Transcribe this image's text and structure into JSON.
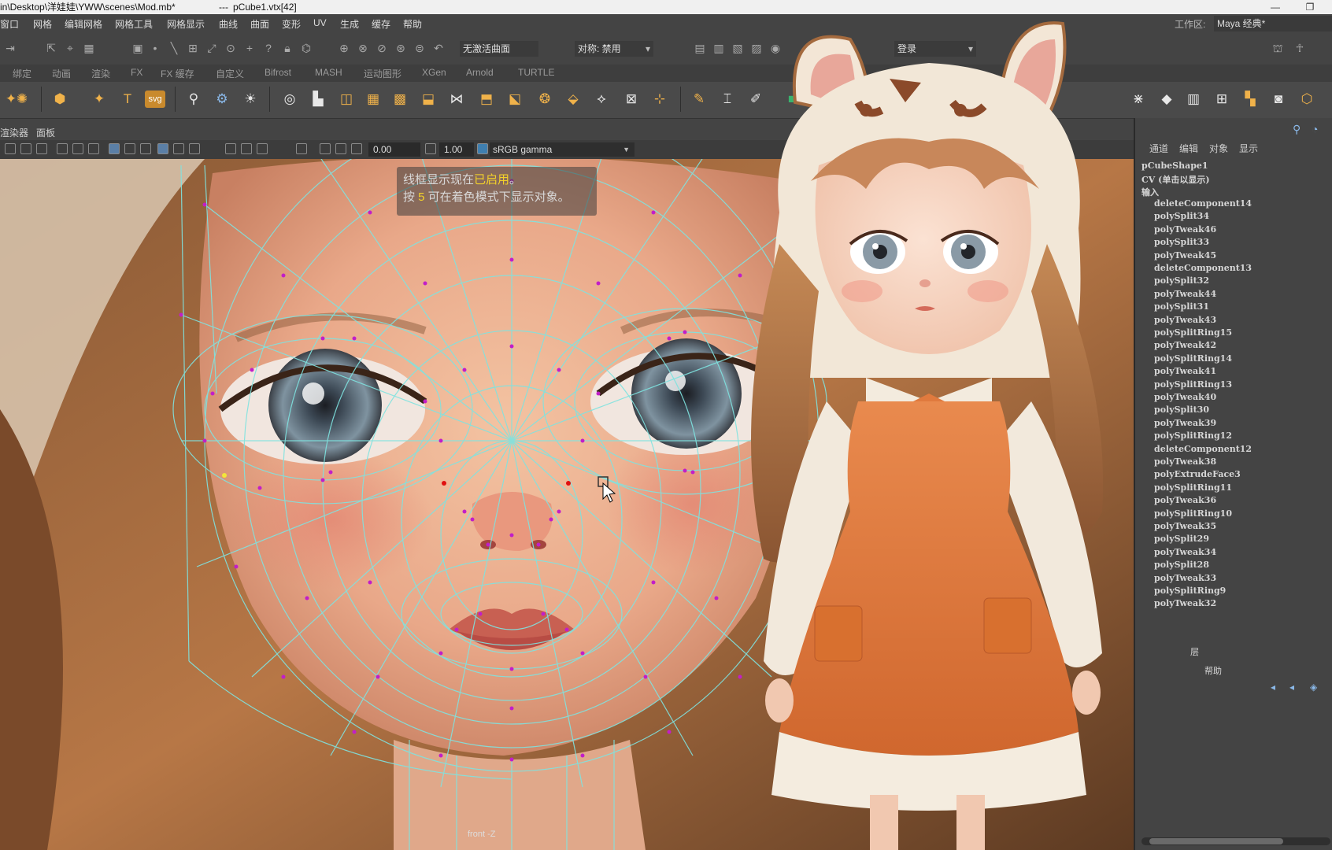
{
  "title_bar": {
    "path": "in\\Desktop\\洋娃娃\\YWW\\scenes\\Mod.mb*",
    "separator": "---",
    "selection": "pCube1.vtx[42]"
  },
  "menu": [
    "窗口",
    "网格",
    "编辑网格",
    "网格工具",
    "网格显示",
    "曲线",
    "曲面",
    "变形",
    "UV",
    "生成",
    "缓存",
    "帮助"
  ],
  "workspace": {
    "label": "工作区:",
    "value": "Maya 经典*"
  },
  "status_line": {
    "live_surface": "无激活曲面",
    "symmetry": "对称: 禁用",
    "login": "登录"
  },
  "shelf_tabs": [
    "绑定",
    "动画",
    "渲染",
    "FX",
    "FX 缓存",
    "自定义",
    "Bifrost",
    "MASH",
    "运动图形",
    "XGen",
    "Arnold",
    "TURTLE"
  ],
  "shelf_icons": [
    "cube-icon",
    "sphere-icon",
    "text-icon",
    "svg-icon",
    "joint-icon",
    "sculpt-icon",
    "light-icon",
    "extrude-icon",
    "multicut-icon"
  ],
  "panel_menu": [
    "渲染器",
    "面板"
  ],
  "viewport_toolbar": {
    "exposure": "0.00",
    "gamma_value": "1.00",
    "color_space": "sRGB gamma"
  },
  "viewport": {
    "hud_line1_prefix": "线框显示现在",
    "hud_line1_highlight": "已启用",
    "hud_line1_suffix": "。",
    "hud_line2_prefix": "按 ",
    "hud_line2_key": "5",
    "hud_line2_suffix": " 可在着色模式下显示对象。",
    "camera_label": "front -Z"
  },
  "channel_box": {
    "tabs": [
      "通道",
      "编辑",
      "对象",
      "显示"
    ],
    "shape_name": "pCubeShape1",
    "cv_label": "CV (单击以显示)",
    "inputs_label": "输入",
    "inputs": [
      "deleteComponent14",
      "polySplit34",
      "polyTweak46",
      "polySplit33",
      "polyTweak45",
      "deleteComponent13",
      "polySplit32",
      "polyTweak44",
      "polySplit31",
      "polyTweak43",
      "polySplitRing15",
      "polyTweak42",
      "polySplitRing14",
      "polyTweak41",
      "polySplitRing13",
      "polyTweak40",
      "polySplit30",
      "polyTweak39",
      "polySplitRing12",
      "deleteComponent12",
      "polyTweak38",
      "polyExtrudeFace3",
      "polySplitRing11",
      "polyTweak36",
      "polySplitRing10",
      "polyTweak35",
      "polySplit29",
      "polyTweak34",
      "polySplit28",
      "polyTweak33",
      "polySplitRing9",
      "polyTweak32"
    ],
    "layer_label": "层",
    "help_label": "帮助"
  },
  "colors": {
    "ui_bg": "#444444",
    "wire": "#7fe3e0",
    "vertex": "#c21ec8",
    "hud_highlight": "#f3d12a",
    "dress_orange": "#e27a3e"
  }
}
